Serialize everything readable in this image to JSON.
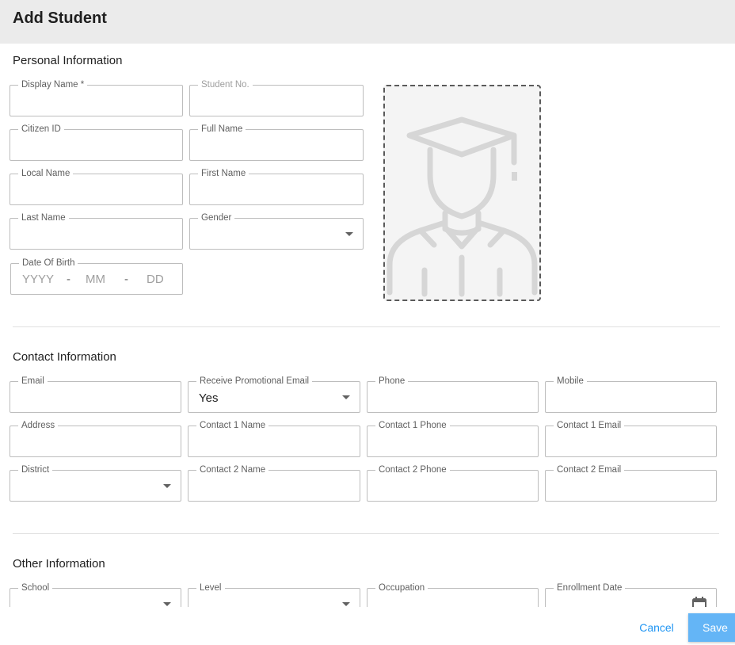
{
  "header": {
    "title": "Add Student"
  },
  "personal": {
    "title": "Personal Information",
    "display_name": "Display Name *",
    "student_no": "Student No.",
    "citizen_id": "Citizen ID",
    "full_name": "Full Name",
    "local_name": "Local Name",
    "first_name": "First Name",
    "last_name": "Last Name",
    "gender": "Gender",
    "dob": {
      "label": "Date Of Birth",
      "yyyy": "YYYY",
      "mm": "MM",
      "dd": "DD",
      "sep": "-"
    },
    "photo_icon": "student-graduate-avatar-icon"
  },
  "contact": {
    "title": "Contact Information",
    "email": "Email",
    "promo_email": {
      "label": "Receive Promotional Email",
      "value": "Yes"
    },
    "phone": "Phone",
    "mobile": "Mobile",
    "address": "Address",
    "c1_name": "Contact 1 Name",
    "c1_phone": "Contact 1 Phone",
    "c1_email": "Contact 1 Email",
    "district": "District",
    "c2_name": "Contact 2 Name",
    "c2_phone": "Contact 2 Phone",
    "c2_email": "Contact 2 Email"
  },
  "other": {
    "title": "Other Information",
    "school": "School",
    "level": "Level",
    "occupation": "Occupation",
    "enrollment_date": "Enrollment Date"
  },
  "actions": {
    "cancel": "Cancel",
    "save": "Save"
  },
  "colors": {
    "header_bg": "#ebebeb",
    "accent": "#2196f3",
    "save_bg": "#64b5f6",
    "photo_bg": "#f4f4f4"
  }
}
